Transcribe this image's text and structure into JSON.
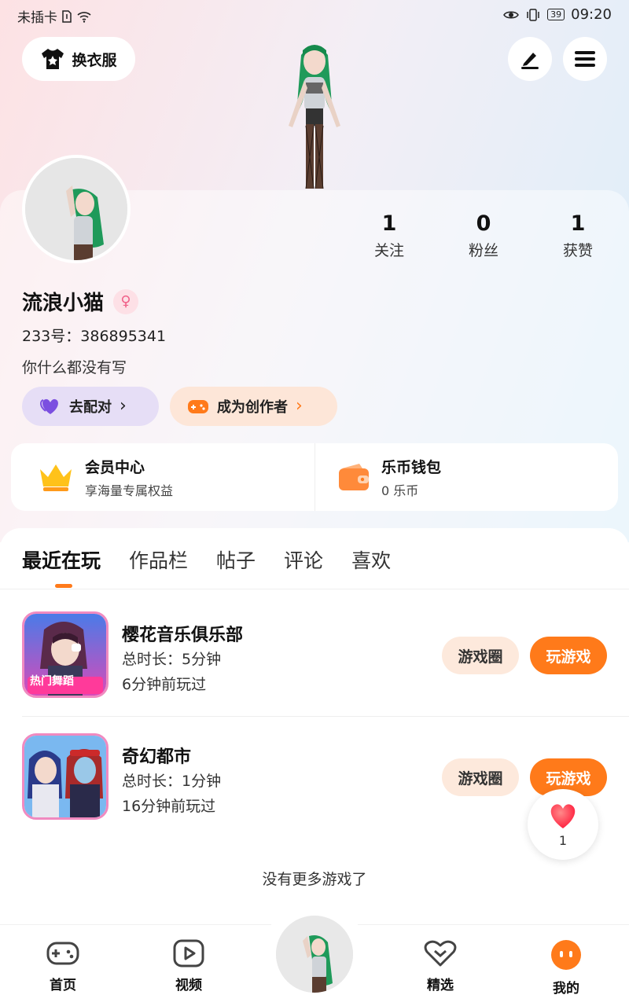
{
  "status_bar": {
    "carrier": "未插卡",
    "battery": "39",
    "time": "09:20"
  },
  "header": {
    "wardrobe_label": "换衣服",
    "edit_icon": "pen-icon",
    "menu_icon": "hamburger-menu-icon"
  },
  "profile": {
    "username": "流浪小猫",
    "gender": "female",
    "uid_line": "233号：386895341",
    "bio": "你什么都没有写",
    "stats": [
      {
        "value": "1",
        "label": "关注"
      },
      {
        "value": "0",
        "label": "粉丝"
      },
      {
        "value": "1",
        "label": "获赞"
      }
    ],
    "match_label": "去配对",
    "creator_label": "成为创作者"
  },
  "member": {
    "title": "会员中心",
    "subtitle": "享海量专属权益"
  },
  "wallet": {
    "title": "乐币钱包",
    "subtitle": "0 乐币"
  },
  "tabs": [
    {
      "label": "最近在玩",
      "active": true
    },
    {
      "label": "作品栏",
      "active": false
    },
    {
      "label": "帖子",
      "active": false
    },
    {
      "label": "评论",
      "active": false
    },
    {
      "label": "喜欢",
      "active": false
    }
  ],
  "games": [
    {
      "name": "樱花音乐俱乐部",
      "duration": "总时长：5分钟",
      "last_played": "6分钟前玩过",
      "icon_text": "热门舞蹈",
      "circle_label": "游戏圈",
      "play_label": "玩游戏"
    },
    {
      "name": "奇幻都市",
      "duration": "总时长：1分钟",
      "last_played": "16分钟前玩过",
      "icon_text": "",
      "circle_label": "游戏圈",
      "play_label": "玩游戏"
    }
  ],
  "no_more_text": "没有更多游戏了",
  "like_bubble": {
    "count": "1"
  },
  "bottom_nav": [
    {
      "label": "首页",
      "icon": "gamepad-icon"
    },
    {
      "label": "视频",
      "icon": "video-play-icon"
    },
    {
      "label": "",
      "icon": "avatar-center"
    },
    {
      "label": "精选",
      "icon": "heart-chevron-icon"
    },
    {
      "label": "我的",
      "icon": "profile-face-icon"
    }
  ],
  "colors": {
    "accent": "#ff7a1a",
    "match_pill": "#e6def6",
    "creator_pill": "#fde6d8",
    "gender_pink": "#f06088"
  }
}
